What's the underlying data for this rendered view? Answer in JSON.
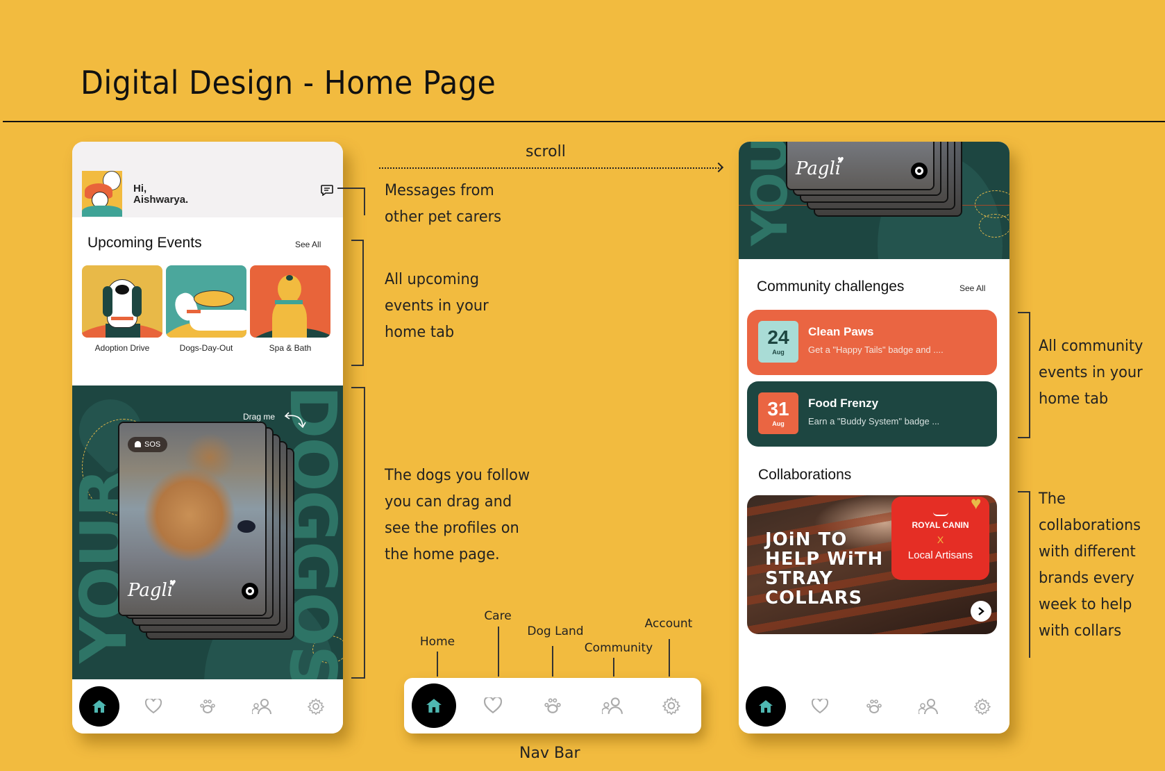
{
  "page": {
    "title": "Digital Design - Home Page",
    "scroll_label": "scroll",
    "navbar_caption": "Nav Bar"
  },
  "left_phone": {
    "greeting_line1": "Hi,",
    "greeting_line2": "Aishwarya.",
    "upcoming_title": "Upcoming Events",
    "see_all": "See All",
    "events": [
      {
        "label": "Adoption Drive",
        "bg": "#E8B948"
      },
      {
        "label": "Dogs-Day-Out",
        "bg": "#4BA79C"
      },
      {
        "label": "Spa & Bath",
        "bg": "#E8643A"
      }
    ],
    "dogs_section": {
      "bg_word_1": "YOUR",
      "bg_word_2": "DOGGOS",
      "drag_hint": "Drag me",
      "sos_label": "SOS",
      "dog_name": "Pagli"
    }
  },
  "right_phone": {
    "dog_name": "Pagli",
    "bg_word": "YOU",
    "challenges_title": "Community challenges",
    "see_all": "See All",
    "challenges": [
      {
        "day": "24",
        "month": "Aug",
        "title": "Clean Paws",
        "desc": "Get a \"Happy Tails\" badge and ....",
        "card_bg": "#EA6542",
        "date_bg": "#A9DCD6",
        "date_color": "#1D4641"
      },
      {
        "day": "31",
        "month": "Aug",
        "title": "Food Frenzy",
        "desc": "Earn a \"Buddy System\" badge ...",
        "card_bg": "#1D4641",
        "date_bg": "#EA6542",
        "date_color": "#FFFFFF"
      }
    ],
    "collab_title": "Collaborations",
    "collab": {
      "headline_1": "JOiN TO",
      "headline_2": "HELP WiTH",
      "headline_3": "STRAY",
      "headline_4": "COLLARS",
      "brand": "ROYAL CANIN",
      "x": "X",
      "partner": "Local Artisans"
    }
  },
  "nav": {
    "items": [
      {
        "label": "Home",
        "icon": "home-icon",
        "active": true
      },
      {
        "label": "Care",
        "icon": "heart-icon",
        "active": false
      },
      {
        "label": "Dog Land",
        "icon": "paw-icon",
        "active": false
      },
      {
        "label": "Community",
        "icon": "community-icon",
        "active": false
      },
      {
        "label": "Account",
        "icon": "gear-icon",
        "active": false
      }
    ]
  },
  "annotations": {
    "messages": [
      "Messages from",
      "other pet carers"
    ],
    "upcoming": [
      "All upcoming",
      "events in your",
      "home tab"
    ],
    "dogs": [
      "The dogs you follow",
      "you can drag and",
      "see the profiles on",
      "the home page."
    ],
    "community": [
      "All community",
      "events in your",
      "home tab"
    ],
    "collabs": [
      "The",
      "collaborations",
      "with different",
      "brands every",
      "week to help",
      "with collars"
    ]
  },
  "colors": {
    "background": "#F2BB3F",
    "dark_green": "#1D4641",
    "accent_teal": "#4FB8B2",
    "coral": "#EA6542",
    "brand_red": "#E52E25",
    "icon_grey": "#AAAAAA"
  }
}
